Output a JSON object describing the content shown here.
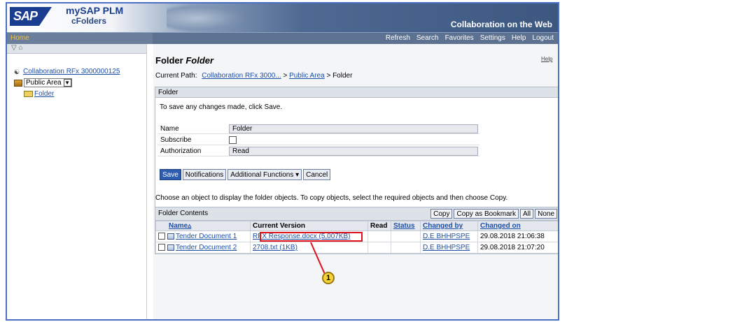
{
  "header": {
    "brand": "SAP",
    "product_line1": "mySAP PLM",
    "product_line2": "cFolders",
    "tagline": "Collaboration on the Web"
  },
  "menubar": {
    "home": "Home",
    "links": [
      "Refresh",
      "Search",
      "Favorites",
      "Settings",
      "Help",
      "Logout"
    ]
  },
  "leftnav": {
    "toolbar": "▽ ⌂",
    "root_label": "Collaboration RFx 3000000125",
    "area_label": "Public Area",
    "folder_label": "Folder"
  },
  "main": {
    "title_prefix": "Folder",
    "title_name": "Folder",
    "help": "Help",
    "crumb_label": "Current Path:",
    "crumb_link1": "Collaboration RFx 3000...",
    "crumb_sep1": " > ",
    "crumb_link2": "Public Area",
    "crumb_tail": " > Folder"
  },
  "panel": {
    "header": "Folder",
    "message": "To save any changes made, click Save.",
    "fields": {
      "name_label": "Name",
      "name_value": "Folder",
      "subscribe_label": "Subscribe",
      "auth_label": "Authorization",
      "auth_value": "Read"
    },
    "buttons": {
      "save": "Save",
      "notifications": "Notifications",
      "additional": "Additional Functions ▾",
      "cancel": "Cancel"
    }
  },
  "instructions": "Choose an object to display the folder objects. To copy objects, select the required objects and then choose Copy.",
  "folder_contents": {
    "title": "Folder Contents",
    "actions": [
      "Copy",
      "Copy as Bookmark",
      "All",
      "None"
    ],
    "columns": [
      "Name▵",
      "Current Version",
      "Read",
      "Status",
      "Changed by",
      "Changed on"
    ],
    "rows": [
      {
        "name": "Tender Document 1",
        "version": "RFX Response.docx (5,007KB)",
        "read": "",
        "status": "",
        "changed_by": "D.E BHHPSPE",
        "changed_on": "29.08.2018 21:06:38"
      },
      {
        "name": "Tender Document 2",
        "version": "2708.txt (1KB)",
        "read": "",
        "status": "",
        "changed_by": "D.E BHHPSPE",
        "changed_on": "29.08.2018 21:07:20"
      }
    ]
  },
  "callout": "1",
  "colors": {
    "frame": "#4a6fc4",
    "highlight": "#e0111b",
    "callout": "#f6d23a",
    "link": "#1d4fa7"
  }
}
